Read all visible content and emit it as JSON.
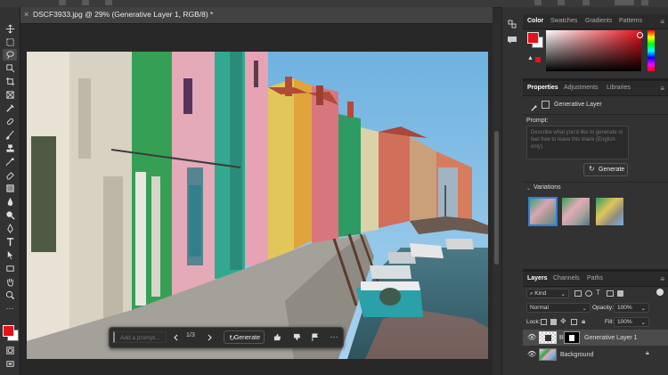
{
  "document": {
    "tab_title": "DSCF3933.jpg @ 29% (Generative Layer 1, RGB/8) *"
  },
  "context_bar": {
    "prompt_placeholder": "Add a prompt...",
    "prev_icon": "chevron-left-icon",
    "page_indicator": "1/3",
    "next_icon": "chevron-right-icon",
    "generate_label": "Generate",
    "more_icon": "more-icon"
  },
  "color_panel": {
    "tabs": [
      "Color",
      "Swatches",
      "Gradients",
      "Patterns"
    ],
    "foreground": "#e8101a",
    "background": "#ffffff",
    "hue": "#e8101a"
  },
  "properties_panel": {
    "tabs": [
      "Properties",
      "Adjustments",
      "Libraries"
    ],
    "layer_type": "Generative Layer",
    "prompt_label": "Prompt:",
    "prompt_placeholder": "Describe what you'd like to generate or feel free to leave this blank (English only).",
    "generate_label": "Generate",
    "variations_label": "Variations"
  },
  "layers_panel": {
    "tabs": [
      "Layers",
      "Channels",
      "Paths"
    ],
    "kind_label": "Kind",
    "blend_mode": "Normal",
    "opacity_label": "Opacity:",
    "opacity_value": "100%",
    "lock_label": "Lock:",
    "fill_label": "Fill:",
    "fill_value": "100%",
    "layers": [
      {
        "name": "Generative Layer 1",
        "visible": true,
        "selected": true
      },
      {
        "name": "Background",
        "visible": true,
        "selected": false,
        "locked": true
      }
    ]
  }
}
